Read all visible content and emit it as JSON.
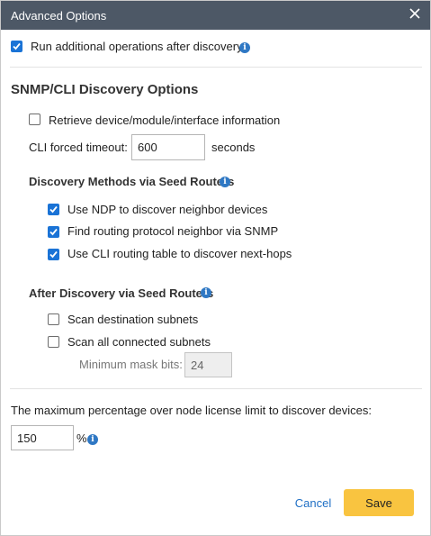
{
  "dialog": {
    "title": "Advanced Options",
    "close_icon": "close-icon"
  },
  "run_additional": {
    "label": "Run additional operations after discovery",
    "checked": true
  },
  "snmp_section": {
    "heading": "SNMP/CLI Discovery Options"
  },
  "retrieve_info": {
    "label": "Retrieve device/module/interface information",
    "checked": false
  },
  "cli_timeout": {
    "label": "CLI forced timeout:",
    "value": "600",
    "unit": "seconds"
  },
  "seed_methods": {
    "heading": "Discovery Methods via Seed Routers",
    "items": [
      {
        "label": "Use NDP to discover neighbor devices",
        "checked": true
      },
      {
        "label": "Find routing protocol neighbor via SNMP",
        "checked": true
      },
      {
        "label": "Use CLI routing table to discover next-hops",
        "checked": true
      }
    ]
  },
  "after_discovery": {
    "heading": "After Discovery via Seed Routers",
    "items": [
      {
        "label": "Scan destination subnets",
        "checked": false
      },
      {
        "label": "Scan all connected subnets",
        "checked": false
      }
    ],
    "mask_label": "Minimum mask bits:",
    "mask_value": "24"
  },
  "license": {
    "label": "The maximum percentage over node license limit to discover devices:",
    "value": "150",
    "unit": "%"
  },
  "footer": {
    "cancel_label": "Cancel",
    "save_label": "Save"
  },
  "colors": {
    "titlebar": "#4d5866",
    "checkbox": "#1a73d6",
    "info": "#2f78c4",
    "save": "#f9c440",
    "link": "#1f6fc5"
  }
}
